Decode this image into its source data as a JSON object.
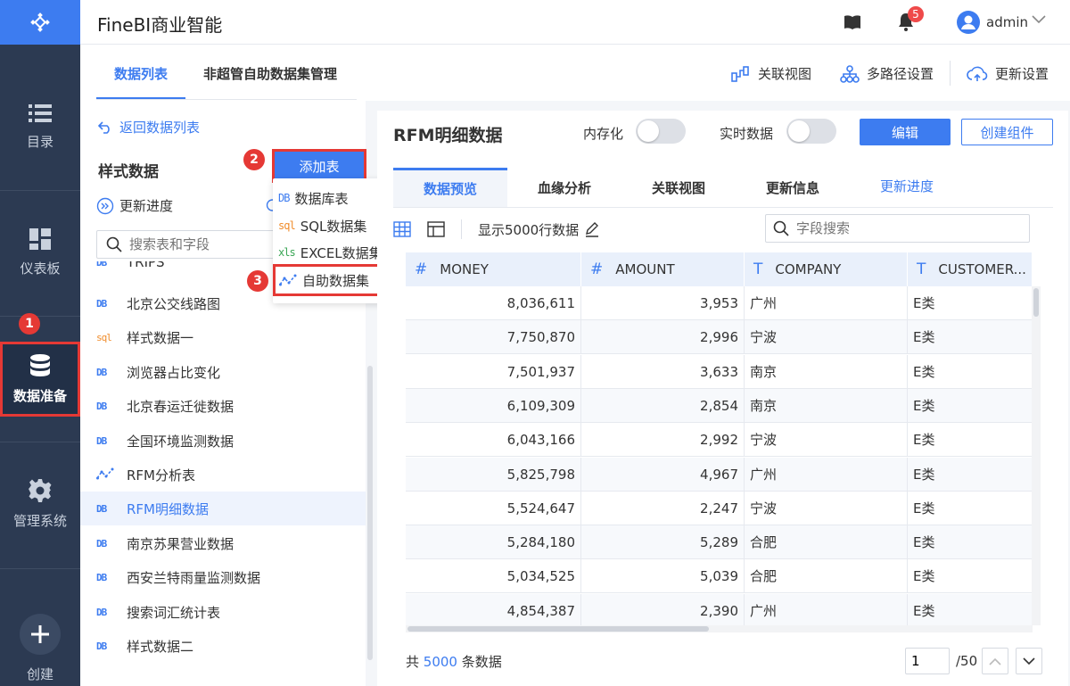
{
  "app": {
    "title": "FineBI商业智能",
    "notifications": "5",
    "user": "admin"
  },
  "rail": [
    {
      "label": "目录",
      "icon": "list-icon"
    },
    {
      "label": "仪表板",
      "icon": "dashboard-icon"
    },
    {
      "label": "数据准备",
      "icon": "database-icon"
    },
    {
      "label": "管理系统",
      "icon": "gear-icon"
    },
    {
      "label": "创建",
      "icon": "plus-icon"
    }
  ],
  "subtabs": [
    "数据列表",
    "非超管自助数据集管理"
  ],
  "tools": {
    "relation_view": "关联视图",
    "multipath": "多路径设置",
    "update_settings": "更新设置"
  },
  "left": {
    "back": "返回数据列表",
    "group": "样式数据",
    "update_progress": "更新进度",
    "search_placeholder": "搜索表和字段",
    "items": [
      {
        "type": "DB",
        "label": "TRIPS"
      },
      {
        "type": "DB",
        "label": "北京公交线路图"
      },
      {
        "type": "sql",
        "label": "样式数据一"
      },
      {
        "type": "DB",
        "label": "浏览器占比变化"
      },
      {
        "type": "DB",
        "label": "北京春运迁徙数据"
      },
      {
        "type": "DB",
        "label": "全国环境监测数据"
      },
      {
        "type": "self",
        "label": "RFM分析表"
      },
      {
        "type": "DB",
        "label": "RFM明细数据"
      },
      {
        "type": "DB",
        "label": "南京苏果营业数据"
      },
      {
        "type": "DB",
        "label": "西安兰特雨量监测数据"
      },
      {
        "type": "DB",
        "label": "搜索词汇统计表"
      },
      {
        "type": "DB",
        "label": "样式数据二"
      }
    ]
  },
  "add_table": {
    "label": "添加表",
    "menu": [
      {
        "tag": "DB",
        "label": "数据库表"
      },
      {
        "tag": "sql",
        "label": "SQL数据集"
      },
      {
        "tag": "xls",
        "label": "EXCEL数据集"
      },
      {
        "tag": "self",
        "label": "自助数据集"
      }
    ]
  },
  "steps": [
    "1",
    "2",
    "3"
  ],
  "main": {
    "title": "RFM明细数据",
    "in_memory": "内存化",
    "realtime": "实时数据",
    "edit": "编辑",
    "create_component": "创建组件",
    "tabs": [
      "数据预览",
      "血缘分析",
      "关联视图",
      "更新信息",
      "更新进度"
    ],
    "show_rows": "显示5000行数据",
    "field_search_placeholder": "字段搜索",
    "columns": [
      {
        "type": "#",
        "name": "MONEY"
      },
      {
        "type": "#",
        "name": "AMOUNT"
      },
      {
        "type": "T",
        "name": "COMPANY"
      },
      {
        "type": "T",
        "name": "CUSTOMER..."
      }
    ],
    "rows": [
      [
        "8,036,611",
        "3,953",
        "广州",
        "E类"
      ],
      [
        "7,750,870",
        "2,996",
        "宁波",
        "E类"
      ],
      [
        "7,501,937",
        "3,633",
        "南京",
        "E类"
      ],
      [
        "6,109,309",
        "2,854",
        "南京",
        "E类"
      ],
      [
        "6,043,166",
        "2,992",
        "宁波",
        "E类"
      ],
      [
        "5,825,798",
        "4,967",
        "广州",
        "E类"
      ],
      [
        "5,524,647",
        "2,247",
        "宁波",
        "E类"
      ],
      [
        "5,284,180",
        "5,289",
        "合肥",
        "E类"
      ],
      [
        "5,034,525",
        "5,039",
        "合肥",
        "E类"
      ],
      [
        "4,854,387",
        "2,390",
        "广州",
        "E类"
      ]
    ],
    "footer": {
      "prefix": "共",
      "count": "5000",
      "suffix": "条数据",
      "page": "1",
      "total": "/50"
    }
  },
  "colors": {
    "accent": "#3d7cf0",
    "rail": "#2c3a52",
    "highlight": "#e53935"
  }
}
